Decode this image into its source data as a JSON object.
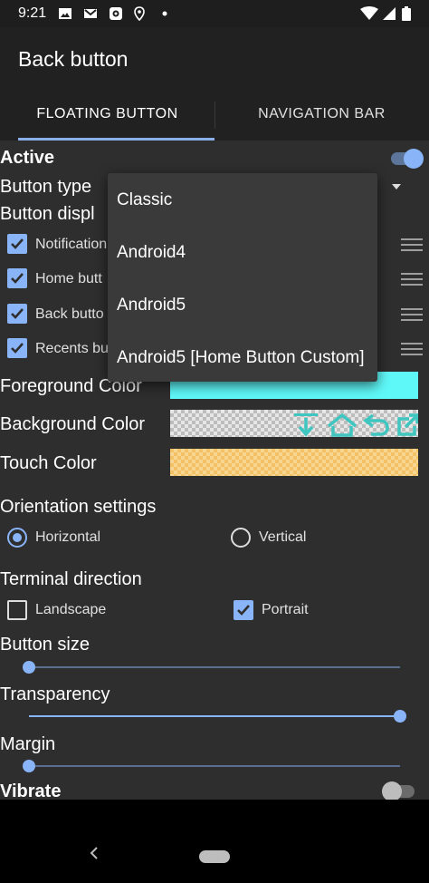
{
  "status_bar": {
    "time": "9:21",
    "left_icons": [
      "image-icon",
      "gmail-icon",
      "photo-app-icon",
      "location-icon",
      "dot-icon"
    ],
    "right_icons": [
      "wifi-icon",
      "signal-icon",
      "battery-icon"
    ]
  },
  "app_bar": {
    "title": "Back button"
  },
  "tabs": [
    {
      "label": "FLOATING BUTTON",
      "selected": true
    },
    {
      "label": "NAVIGATION BAR",
      "selected": false
    }
  ],
  "settings": {
    "active_label": "Active",
    "active_on": true,
    "button_type_label": "Button type",
    "button_display_label": "Button displ",
    "display_items": [
      {
        "label": "Notification",
        "checked": true
      },
      {
        "label": "Home butt",
        "checked": true
      },
      {
        "label": "Back butto",
        "checked": true
      },
      {
        "label": "Recents bu",
        "checked": true
      }
    ],
    "foreground_label": "Foreground Color",
    "background_label": "Background Color",
    "touch_label": "Touch Color",
    "orientation_label": "Orientation settings",
    "orientation_options": [
      {
        "label": "Horizontal",
        "selected": true
      },
      {
        "label": "Vertical",
        "selected": false
      }
    ],
    "terminal_label": "Terminal direction",
    "terminal_options": [
      {
        "label": "Landscape",
        "checked": false
      },
      {
        "label": "Portrait",
        "checked": true
      }
    ],
    "button_size_label": "Button size",
    "button_size_value": 0.0,
    "transparency_label": "Transparency",
    "transparency_value": 1.0,
    "margin_label": "Margin",
    "margin_value": 0.0,
    "vibrate_label": "Vibrate",
    "vibrate_on": false
  },
  "dropdown": {
    "options": [
      "Classic",
      "Android4",
      "Android5",
      "Android5 [Home Button Custom]"
    ]
  },
  "colors": {
    "accent": "#8ab4f8",
    "foreground_swatch": "#5ff8f8",
    "touch_swatch": "#f4c265",
    "preview_icon": "#3fc6c0"
  },
  "preview_icons": [
    "notification-down-icon",
    "home-icon",
    "back-icon",
    "recents-icon"
  ]
}
